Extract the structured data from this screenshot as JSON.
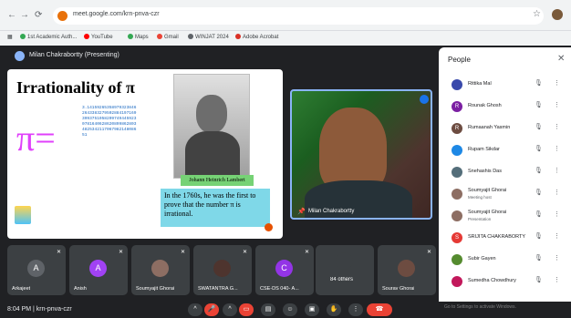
{
  "browser": {
    "url": "meet.google.com/krn-pnva-czr",
    "bookmarks": [
      "1st Academic Auth...",
      "YouTube",
      "Maps",
      "Gmail",
      "WINJAT 2024",
      "Adobe Acrobat"
    ]
  },
  "meeting": {
    "presenter_label": "Milan Chakrabortty (Presenting)",
    "time": "8:04 PM",
    "code": "krn-pnva-czr"
  },
  "slide": {
    "title": "Irrationality of π",
    "pi_symbol": "π=",
    "digits": "3.14159265358979323846264338327950288419716939937510582097494459230781640628620899862803482534211706798214808651",
    "portrait_caption": "Johann Heinrich Lambert",
    "body": "In the 1760s, he was the first to prove that the number π is irrational."
  },
  "camera": {
    "name": "Milan Chakrabortty"
  },
  "tiles": [
    {
      "name": "Arkajeet",
      "initial": "A",
      "color": "#5f6368"
    },
    {
      "name": "Anish",
      "initial": "A",
      "color": "#a142f4"
    },
    {
      "name": "Soumyajit Ghorai",
      "initial": "",
      "color": "#8d6e63"
    },
    {
      "name": "SWATANTRA G...",
      "initial": "",
      "color": "#4e342e"
    },
    {
      "name": "CSE-DS 040- A...",
      "initial": "C",
      "color": "#9334e6"
    },
    {
      "name": "84 others",
      "initial": "",
      "color": "#3c4043"
    },
    {
      "name": "Sourav Ghorai",
      "initial": "",
      "color": "#6d4c41"
    }
  ],
  "people_panel": {
    "title": "People",
    "close": "✕",
    "items": [
      {
        "name": "Rittika Mal",
        "sub": "",
        "initial": "",
        "color": "#3949ab"
      },
      {
        "name": "Rounak Ghosh",
        "sub": "",
        "initial": "R",
        "color": "#7b1fa2"
      },
      {
        "name": "Rumaanah Yasmin",
        "sub": "",
        "initial": "R",
        "color": "#6d4c41"
      },
      {
        "name": "Rupam Sikdar",
        "sub": "",
        "initial": "",
        "color": "#1e88e5"
      },
      {
        "name": "Snehashis Das",
        "sub": "",
        "initial": "",
        "color": "#546e7a"
      },
      {
        "name": "Soumyajit Ghorai",
        "sub": "Meeting host",
        "initial": "",
        "color": "#8d6e63"
      },
      {
        "name": "Soumyajit Ghorai",
        "sub": "Presentation",
        "initial": "",
        "color": "#8d6e63"
      },
      {
        "name": "SRIJITA CHAKRABORTY",
        "sub": "",
        "initial": "S",
        "color": "#e53935"
      },
      {
        "name": "Subir Gayen",
        "sub": "",
        "initial": "",
        "color": "#558b2f"
      },
      {
        "name": "Sumedha Chowdhury",
        "sub": "",
        "initial": "",
        "color": "#c2185b"
      }
    ]
  },
  "watermark": {
    "title": "Activate Windows",
    "sub": "Go to Settings to activate Windows."
  }
}
